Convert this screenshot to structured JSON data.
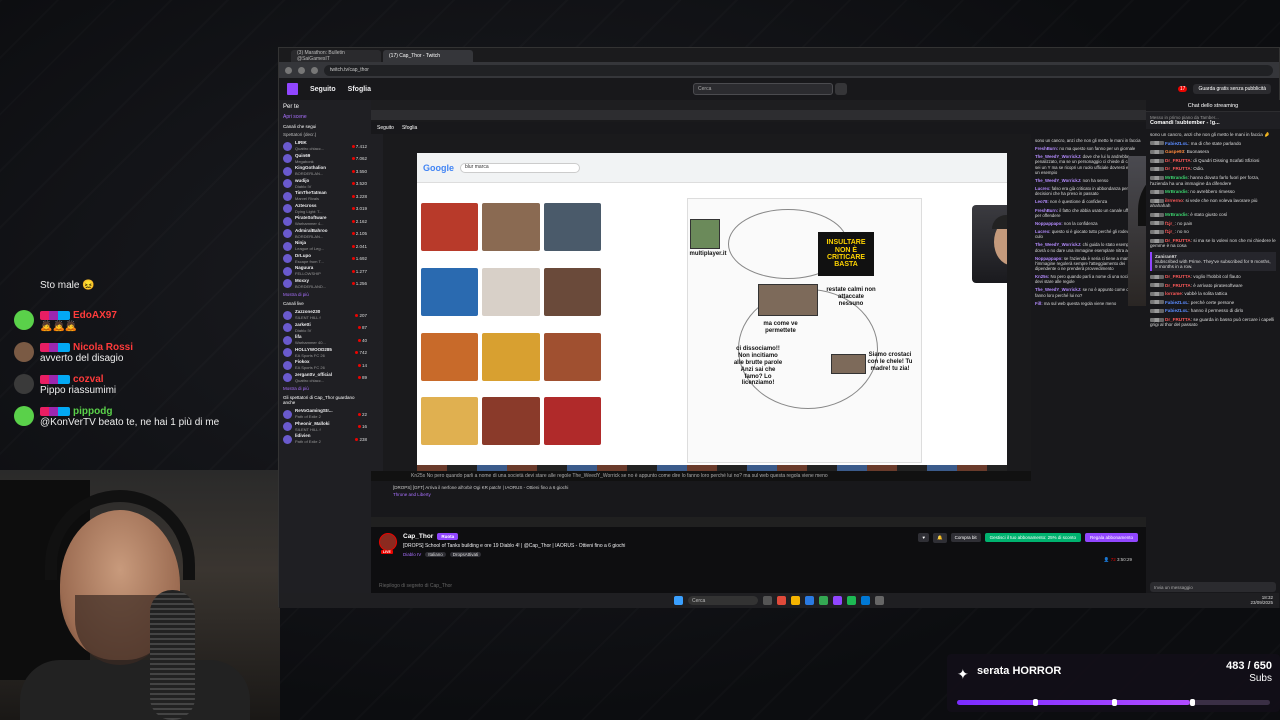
{
  "overlay_chat": [
    {
      "name": "",
      "name_color": "#ffffff",
      "text": "Sto male 😖",
      "avatar": "#00000000"
    },
    {
      "name": "EdoAX97",
      "name_color": "#ff3b3b",
      "text": "🙇🙇🙇",
      "avatar": "#5ad14a"
    },
    {
      "name": "Nicola Rossi",
      "name_color": "#ff3b3b",
      "text": "avverto del disagio",
      "avatar": "#7a5a44"
    },
    {
      "name": "cozval",
      "name_color": "#ff3b3b",
      "text": "Pippo riassumimi",
      "avatar": "#3a3a3a"
    },
    {
      "name": "pippodg",
      "name_color": "#5ad14a",
      "text": "@KonVerTV beato te, ne hai 1 più di me",
      "avatar": "#5ad14a"
    }
  ],
  "browser": {
    "tabs": [
      "(3) Marathon: Bulletin @SaiGamesIT",
      "(17) Cap_Thor - Twitch"
    ],
    "url": "twitch.tv/cap_thor"
  },
  "twitch": {
    "nav_following": "Seguito",
    "nav_browse": "Sfoglia",
    "search_placeholder": "Cerca",
    "prime_label": "Guarda gratis senza pubblicità",
    "notif_count": "17"
  },
  "sidebar": {
    "title": "Per te",
    "open_label": "Apri scene",
    "followed_header": "Canali che segui",
    "followed_sub": "Spettatori (decr.)",
    "followed": [
      {
        "name": "LIRIK",
        "game": "Quattro chiacc...",
        "count": "7.412"
      },
      {
        "name": "Quin69",
        "game": "Megabonk",
        "count": "7.062"
      },
      {
        "name": "KingGothalion",
        "game": "BORDERLAN...",
        "count": "3.550"
      },
      {
        "name": "wudijo",
        "game": "Diablo IV",
        "count": "3.520"
      },
      {
        "name": "TimTheTatman",
        "game": "Marvel Rivals",
        "count": "3.228"
      },
      {
        "name": "Aztecross",
        "game": "Dying Light: T...",
        "count": "3.019"
      },
      {
        "name": "PirateSoftware",
        "game": "Warhammer 4...",
        "count": "2.162"
      },
      {
        "name": "AdmiralBahroo",
        "game": "BORDERLAN...",
        "count": "2.105"
      },
      {
        "name": "Ninja",
        "game": "League of Leg...",
        "count": "2.041"
      },
      {
        "name": "DrLupo",
        "game": "Escape from T...",
        "count": "1.692"
      },
      {
        "name": "Naguura",
        "game": "FELLOWSHIP",
        "count": "1.277"
      },
      {
        "name": "Moxxy",
        "game": "BORDERLAND...",
        "count": "1.256"
      }
    ],
    "more_label": "Mostra di più",
    "live_header": "Canali live",
    "live": [
      {
        "name": "Zazzone230",
        "game": "SILENT HILL f",
        "count": "207"
      },
      {
        "name": "zarketti",
        "game": "Diablo IV",
        "count": "87"
      },
      {
        "name": "lifa",
        "game": "Warhammer 40...",
        "count": "40"
      },
      {
        "name": "HOLLYWOOD285",
        "game": "EA Sports FC 26",
        "count": "742"
      },
      {
        "name": "Fiokox",
        "game": "EA Sports FC 26",
        "count": "14"
      },
      {
        "name": "zerganttv_official",
        "game": "Quattro chiacc...",
        "count": "89"
      }
    ],
    "more_label_2": "Mostra di più",
    "also_header": "Gli spettatori di Cap_Thor guardano anche",
    "also": [
      {
        "name": "ReVoGamingStr...",
        "game": "Path of Exile 2",
        "count": "22"
      },
      {
        "name": "Pheonir_Malloki",
        "game": "SILENT HILL f",
        "count": "16"
      },
      {
        "name": "lidivien",
        "game": "Path of Exile 2",
        "count": "238"
      }
    ]
  },
  "stream": {
    "inner_chat_scroll": "Kn25s   No pero quando parli a nome di una società devi stare alle regole     The_WeedY_Worrick   se no è appunto come dire lo fanno loro perché lui no?     ma sul web questa regola viene meno",
    "inner_title": "[DROPS] [GFT] Arriva il nerfone all'orbi! Ogi KR patch! | IAORUS - Ottieni fino a 6 giochi",
    "inner_game": "Throne and Liberty",
    "google_logo": "Google",
    "google_query": "blur marca",
    "paint_labels": {
      "multiplayer": "multiplayer.it",
      "banner": "INSULTARE NON È CRITICARE BASTA",
      "calm": "restate calmi non attaccate nessuno",
      "how": "ma come ve permettete",
      "fire": "ci dissociamo!! Non incitiamo alle brutte parole Anzi sai che famo? Lo licenziamo!",
      "chill": "Siamo crostaci con le chele! Tu madre! tu zia!"
    },
    "inner_chat": [
      {
        "name": "",
        "text": "sono un cancro, anzi che non gli metto le mani in faccia"
      },
      {
        "name": "FreshBurn",
        "text": "no ma questo son fanno per un giornale"
      },
      {
        "name": "The_WeedY_WorrickJ",
        "text": "dove che lui lo andrebbe penalizzato, ma se un personaggio ci chiede di cazzate sei un Y ma se ricopri un ruolo ufficiale dovresti essere un esempio"
      },
      {
        "name": "The_WeedY_WorrickJ",
        "text": "non ha senso"
      },
      {
        "name": "Lucrex",
        "text": "falso era già criticato in abbondanza per decisioni che ha preso in passato"
      },
      {
        "name": "Leo78",
        "text": "non è questione di confidenza"
      },
      {
        "name": "FreshBurn",
        "text": "il fatto che abbia usato un canale ufficiale per offendere"
      },
      {
        "name": "Noppappapo",
        "text": "non la confidenza"
      },
      {
        "name": "Lucrex",
        "text": "questo si è giocato tutto perché gli rodeva il culo"
      },
      {
        "name": "The_WeedY_WorrickJ",
        "text": "chi guida lo stato esempio dovrà o no dare una immagine esemplare nitra agli altri"
      },
      {
        "name": "Noppappapo",
        "text": "se l'azienda è seria ci tiene a mantenere l'immagine regolerà sempre l'atteggiamento dei dipendente o ne prenderà provvedimento"
      },
      {
        "name": "Kn25s",
        "text": "No pero quando parli a nome di una società devi stare alle regole"
      },
      {
        "name": "The_WeedY_WorrickJ",
        "text": "se no è appunto come dire lo fanno loro perché lui no?"
      },
      {
        "name": "Fill",
        "text": "ma sul web questa regola viene meno"
      }
    ]
  },
  "channel": {
    "name": "Cap_Thor",
    "follow_label": "Ruota",
    "live_badge": "LIVE",
    "title": "[DROPS] School of Tanks building e ore 19 Diablo 4! | @Cap_Thor | IAORUS - Ottieni fino a 6 giochi",
    "category": "Diablo IV",
    "tags": [
      "Italiano",
      "DropsAttivati"
    ],
    "buy_bits": "Compra bit",
    "sub_offer": "Gestisci il tuo abbonamento: 25% di sconto",
    "gift_sub": "Regala abbonamento",
    "viewers": "72",
    "uptime": "3:50:29",
    "below_text": "Riepilogo di segreto di Cap_Thor"
  },
  "chat": {
    "header": "Chat dello streaming",
    "pinned": "Comandi !subtember - !g...",
    "input_placeholder": "Invia un messaggio",
    "send_label": "Chat",
    "pinned_sender": "Messo in primo piano da Tamber...",
    "messages": [
      {
        "name": "",
        "color": "#dddddd",
        "text": "sono un cancro, anzi che non gli metto le mani in faccia 🤌"
      },
      {
        "name": "FabieZLoL",
        "color": "#5b8cff",
        "text": "ma di che state parlando"
      },
      {
        "name": "Gaspe93",
        "color": "#ff8a3c",
        "text": "Buonasera"
      },
      {
        "name": "Dr_FRUTTA",
        "color": "#ff5a5a",
        "text": "di Quadri Dissing Scafati Sfiziosi"
      },
      {
        "name": "Dr_FRUTTA",
        "color": "#ff5a5a",
        "text": "Odio."
      },
      {
        "name": "MrBrandis",
        "color": "#3cd26e",
        "text": "hanno dovuto farlo fuori per forza, l'azienda ha una immagine da difendere"
      },
      {
        "name": "MrBrandis",
        "color": "#3cd26e",
        "text": "no avrebbero rimesso"
      },
      {
        "name": "ilrrrerno",
        "color": "#ff5a5a",
        "text": "si vede che non voleva lavorare più ahahahah"
      },
      {
        "name": "MrBrandis",
        "color": "#3cd26e",
        "text": "è stato giusto così"
      },
      {
        "name": "f1jr_",
        "color": "#ff5a5a",
        "text": "no pain"
      },
      {
        "name": "f1jr_",
        "color": "#ff5a5a",
        "text": "no no"
      },
      {
        "name": "Dr_FRUTTA",
        "color": "#ff5a5a",
        "text": "si ma se lo volevi non che mi chiedere le gemme è na cosa"
      },
      {
        "name": "Dr_FRUTTA",
        "color": "#ff5a5a",
        "text": "voglio l'hobbit col flauto"
      },
      {
        "name": "Dr_FRUTTA",
        "color": "#ff5a5a",
        "text": "è arrivato piratesoftware"
      },
      {
        "name": "lorrame",
        "color": "#ff5a5a",
        "text": "vabbè la solita tattica"
      },
      {
        "name": "FabieZLoL",
        "color": "#5b8cff",
        "text": "perchè certe persone"
      },
      {
        "name": "FabieZLoL",
        "color": "#5b8cff",
        "text": "hanno il permesso di dirlo"
      },
      {
        "name": "Dr_FRUTTA",
        "color": "#ff5a5a",
        "text": "se guarda in basso può cercare i capelli grigi al thor del passato"
      }
    ],
    "sub_notice": {
      "name": "Zaniran97",
      "line1": "Subscribed with Prime. They've subscribed for 9 months, 9 months in a row."
    }
  },
  "taskbar": {
    "search": "Cerca",
    "time": "18:32",
    "date": "23/09/2025"
  },
  "subgoal": {
    "title": "serata HORROR",
    "current": 483,
    "target": 650,
    "count_text": "483 / 650",
    "unit": "Subs",
    "progress": 0.743,
    "markers": [
      0.25,
      0.5,
      0.75
    ]
  }
}
